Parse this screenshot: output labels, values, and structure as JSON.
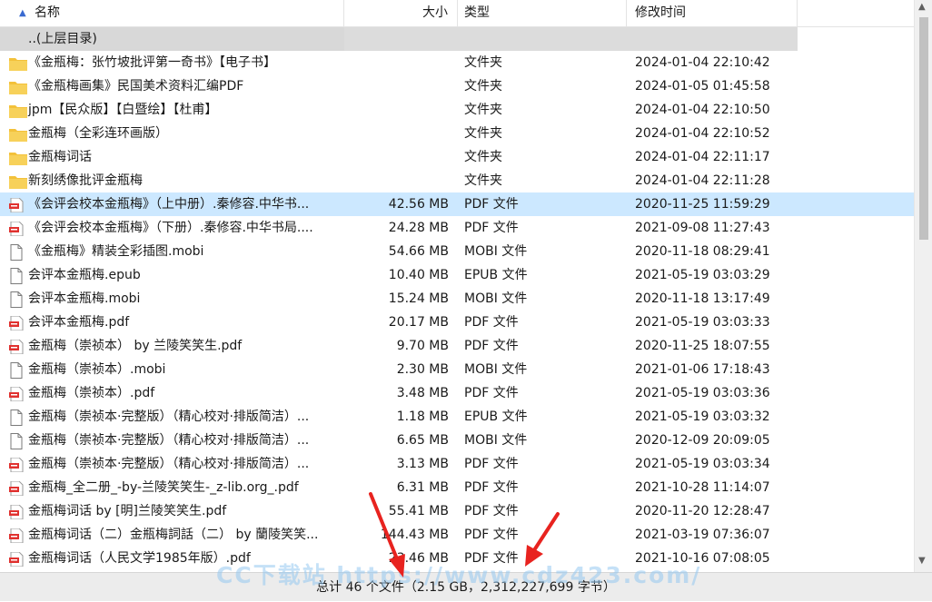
{
  "columns": {
    "name": "名称",
    "size": "大小",
    "type": "类型",
    "date": "修改时间"
  },
  "rows": [
    {
      "icon": "folder-icon",
      "name": "..(上层目录)",
      "size": "",
      "type": "",
      "date": ""
    },
    {
      "icon": "folder-icon",
      "name": "《金瓶梅：张竹坡批评第一奇书》【电子书】",
      "size": "",
      "type": "文件夹",
      "date": "2024-01-04 22:10:42"
    },
    {
      "icon": "folder-icon",
      "name": "《金瓶梅画集》民国美术资料汇编PDF",
      "size": "",
      "type": "文件夹",
      "date": "2024-01-05 01:45:58"
    },
    {
      "icon": "folder-icon",
      "name": "jpm【民众版】【白暨绘】【杜甫】",
      "size": "",
      "type": "文件夹",
      "date": "2024-01-04 22:10:50"
    },
    {
      "icon": "folder-icon",
      "name": "金瓶梅（全彩连环画版）",
      "size": "",
      "type": "文件夹",
      "date": "2024-01-04 22:10:52"
    },
    {
      "icon": "folder-icon",
      "name": "金瓶梅词话",
      "size": "",
      "type": "文件夹",
      "date": "2024-01-04 22:11:17"
    },
    {
      "icon": "folder-icon",
      "name": "新刻绣像批评金瓶梅",
      "size": "",
      "type": "文件夹",
      "date": "2024-01-04 22:11:28"
    },
    {
      "icon": "pdf-file-icon",
      "name": "《会评会校本金瓶梅》（上中册）.秦修容.中华书...",
      "size": "42.56 MB",
      "type": "PDF 文件",
      "date": "2020-11-25 11:59:29"
    },
    {
      "icon": "pdf-file-icon",
      "name": "《会评会校本金瓶梅》（下册）.秦修容.中华书局....",
      "size": "24.28 MB",
      "type": "PDF 文件",
      "date": "2021-09-08 11:27:43"
    },
    {
      "icon": "file-icon",
      "name": "《金瓶梅》精装全彩插图.mobi",
      "size": "54.66 MB",
      "type": "MOBI 文件",
      "date": "2020-11-18 08:29:41"
    },
    {
      "icon": "file-icon",
      "name": "会评本金瓶梅.epub",
      "size": "10.40 MB",
      "type": "EPUB 文件",
      "date": "2021-05-19 03:03:29"
    },
    {
      "icon": "file-icon",
      "name": "会评本金瓶梅.mobi",
      "size": "15.24 MB",
      "type": "MOBI 文件",
      "date": "2020-11-18 13:17:49"
    },
    {
      "icon": "pdf-file-icon",
      "name": "会评本金瓶梅.pdf",
      "size": "20.17 MB",
      "type": "PDF 文件",
      "date": "2021-05-19 03:03:33"
    },
    {
      "icon": "pdf-file-icon",
      "name": "金瓶梅（崇祯本） by 兰陵笑笑生.pdf",
      "size": "9.70 MB",
      "type": "PDF 文件",
      "date": "2020-11-25 18:07:55"
    },
    {
      "icon": "file-icon",
      "name": "金瓶梅（崇祯本）.mobi",
      "size": "2.30 MB",
      "type": "MOBI 文件",
      "date": "2021-01-06 17:18:43"
    },
    {
      "icon": "pdf-file-icon",
      "name": "金瓶梅（崇祯本）.pdf",
      "size": "3.48 MB",
      "type": "PDF 文件",
      "date": "2021-05-19 03:03:36"
    },
    {
      "icon": "file-icon",
      "name": "金瓶梅（崇祯本·完整版）（精心校对·排版简洁）...",
      "size": "1.18 MB",
      "type": "EPUB 文件",
      "date": "2021-05-19 03:03:32"
    },
    {
      "icon": "file-icon",
      "name": "金瓶梅（崇祯本·完整版）（精心校对·排版简洁）...",
      "size": "6.65 MB",
      "type": "MOBI 文件",
      "date": "2020-12-09 20:09:05"
    },
    {
      "icon": "pdf-file-icon",
      "name": "金瓶梅（崇祯本·完整版）（精心校对·排版简洁）...",
      "size": "3.13 MB",
      "type": "PDF 文件",
      "date": "2021-05-19 03:03:34"
    },
    {
      "icon": "pdf-file-icon",
      "name": "金瓶梅_全二册_-by-兰陵笑笑生-_z-lib.org_.pdf",
      "size": "6.31 MB",
      "type": "PDF 文件",
      "date": "2021-10-28 11:14:07"
    },
    {
      "icon": "pdf-file-icon",
      "name": "金瓶梅词话 by [明]兰陵笑笑生.pdf",
      "size": "55.41 MB",
      "type": "PDF 文件",
      "date": "2020-11-20 12:28:47"
    },
    {
      "icon": "pdf-file-icon",
      "name": "金瓶梅词话（二）金瓶梅詞話（二） by 蘭陵笑笑...",
      "size": "144.43 MB",
      "type": "PDF 文件",
      "date": "2021-03-19 07:36:07"
    },
    {
      "icon": "pdf-file-icon",
      "name": "金瓶梅词话（人民文学1985年版）.pdf",
      "size": "23.46 MB",
      "type": "PDF 文件",
      "date": "2021-10-16 07:08:05"
    }
  ],
  "selected_row": 7,
  "status": "总计 46 个文件（2.15 GB，2,312,227,699 字节）",
  "watermark": "CC下载站 https://www.cdz423.com/",
  "colors": {
    "folder": "#f3c13a",
    "pdf": "#e0312f",
    "selection": "#cce8ff",
    "arrow": "#e8231f"
  }
}
